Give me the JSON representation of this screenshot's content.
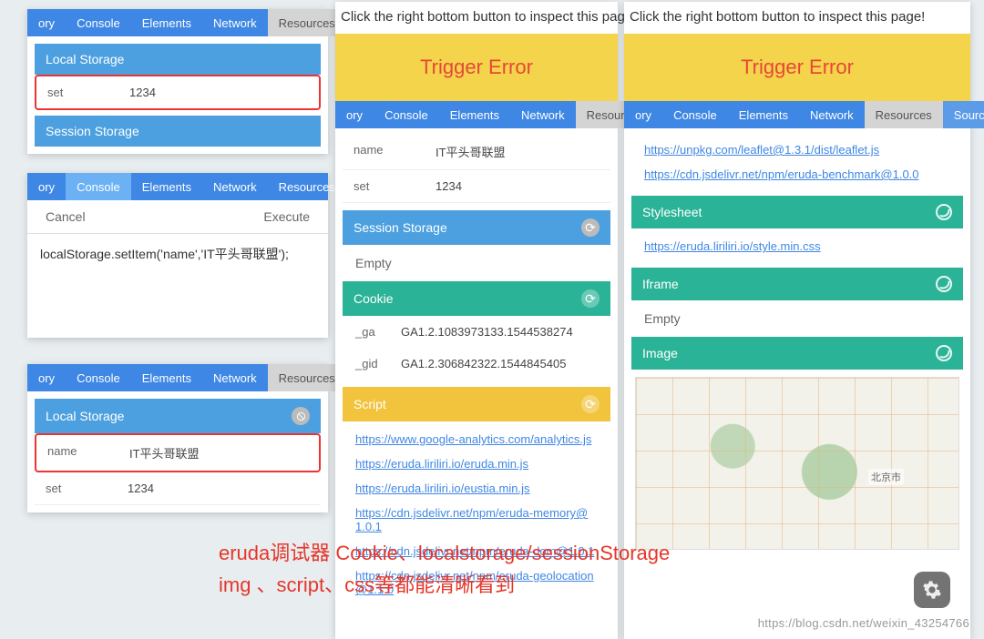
{
  "tabs": {
    "ory": "ory",
    "console": "Console",
    "elements": "Elements",
    "network": "Network",
    "resources": "Resources",
    "sources": "Sources",
    "s": "S"
  },
  "hint": "Click the right bottom button to inspect this page!",
  "trigger": "Trigger Error",
  "panel1": {
    "localStorage": {
      "title": "Local Storage",
      "rows": [
        {
          "k": "set",
          "v": "1234"
        }
      ]
    },
    "sessionStorage": {
      "title": "Session Storage"
    }
  },
  "panel2": {
    "cancel": "Cancel",
    "execute": "Execute",
    "code": "localStorage.setItem('name','IT平头哥联盟');"
  },
  "panel3": {
    "localStorage": {
      "title": "Local Storage",
      "rows": [
        {
          "k": "name",
          "v": "IT平头哥联盟"
        },
        {
          "k": "set",
          "v": "1234"
        }
      ]
    }
  },
  "panel4": {
    "localRows": [
      {
        "k": "name",
        "v": "IT平头哥联盟"
      },
      {
        "k": "set",
        "v": "1234"
      }
    ],
    "session": {
      "title": "Session Storage",
      "empty": "Empty"
    },
    "cookie": {
      "title": "Cookie",
      "rows": [
        {
          "k": "_ga",
          "v": "GA1.2.1083973133.1544538274"
        },
        {
          "k": "_gid",
          "v": "GA1.2.306842322.1544845405"
        }
      ]
    },
    "script": {
      "title": "Script",
      "links": [
        "https://www.google-analytics.com/analytics.js",
        "https://eruda.liriliri.io/eruda.min.js",
        "https://eruda.liriliri.io/eustia.min.js",
        "https://cdn.jsdelivr.net/npm/eruda-memory@1.0.1",
        "https://cdn.jsdelivr.net/npm/eruda-dom@1.0.1",
        "https://cdn.jsdelivr.net/npm/eruda-geolocation@1.1.0"
      ]
    }
  },
  "panel5": {
    "links_top": [
      "https://unpkg.com/leaflet@1.3.1/dist/leaflet.js",
      "https://cdn.jsdelivr.net/npm/eruda-benchmark@1.0.0"
    ],
    "stylesheet": {
      "title": "Stylesheet",
      "links": [
        "https://eruda.liriliri.io/style.min.css"
      ]
    },
    "iframe": {
      "title": "Iframe",
      "empty": "Empty"
    },
    "image": {
      "title": "Image"
    }
  },
  "annotation": {
    "l1": "eruda调试器 Cookie、localstorage/sessionStorage",
    "l2": "img 、script、css等都能清晰看到"
  },
  "watermark": "https://blog.csdn.net/weixin_43254766"
}
